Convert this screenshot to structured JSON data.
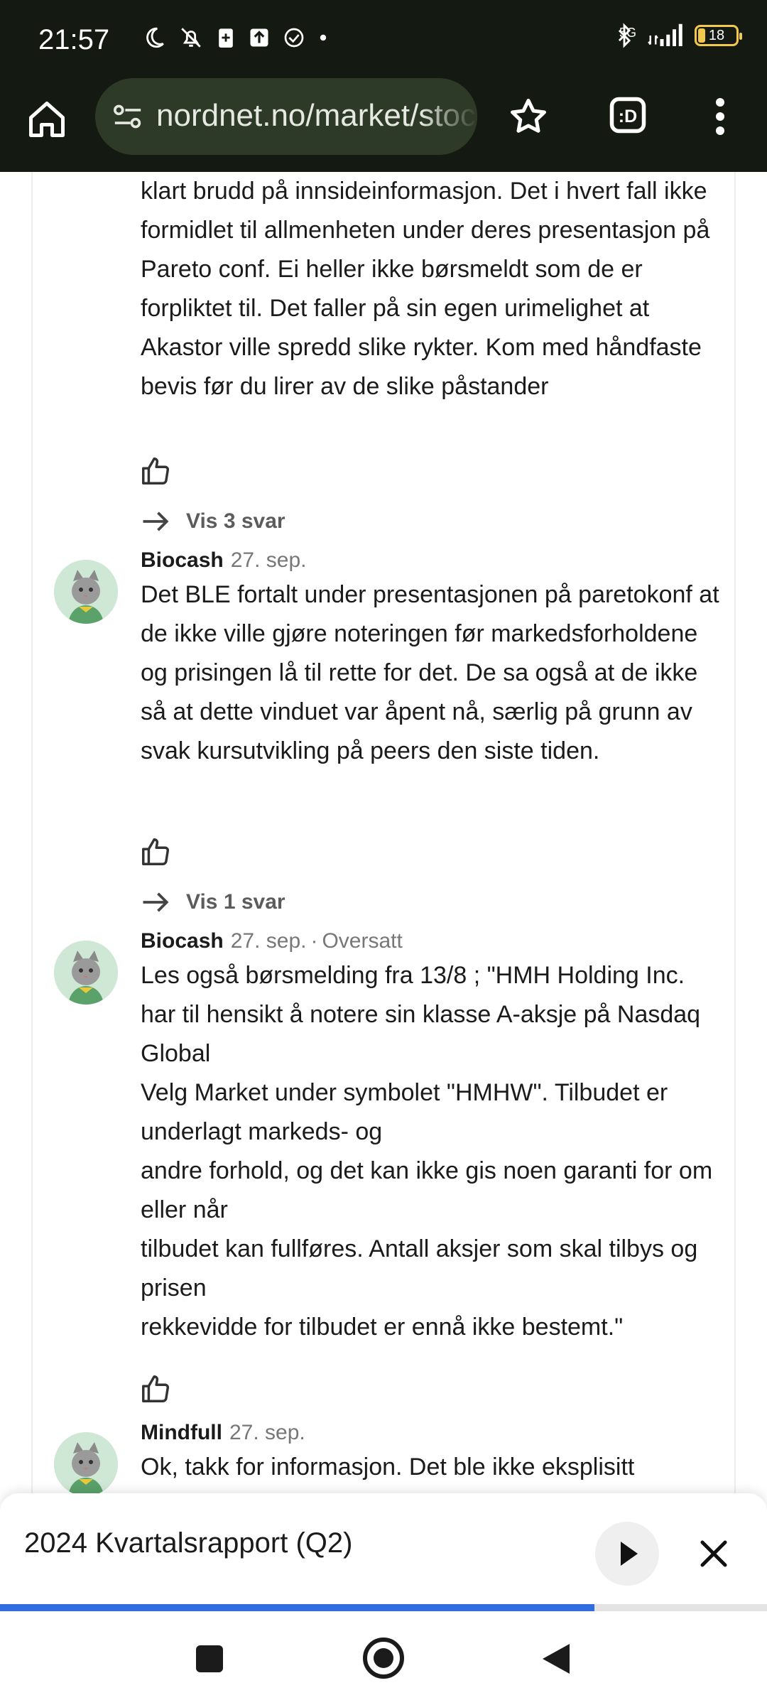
{
  "status_bar": {
    "time": "21:57",
    "network": "5G",
    "battery": "18",
    "icons": [
      "moon-icon",
      "bell-off-icon",
      "battery-saver-icon",
      "upload-icon",
      "check-circle-icon",
      "dot-icon",
      "bluetooth-icon",
      "signal-icon"
    ]
  },
  "browser": {
    "url": "nordnet.no/market/stocks",
    "icons": [
      "home-icon",
      "site-settings-icon",
      "star-icon",
      "tabs-icon",
      "more-icon"
    ]
  },
  "comments": {
    "top_text": "klart brudd på innsideinformasjon. Det i hvert fall ikke formidlet til allmenheten under deres presentasjon på Pareto conf. Ei heller ikke børsmeldt som de er forpliktet til. Det faller på sin egen urimelighet at Akastor ville spredd slike rykter. Kom med håndfaste bevis før du lirer av de slike påstander",
    "top_replies": "Vis 3 svar",
    "c1": {
      "author": "Biocash",
      "date": "27. sep.",
      "text": "Det BLE fortalt under presentasjonen på paretokonf at de ikke ville gjøre noteringen før markedsforholdene og prisingen lå til rette for det. De sa også at de ikke så at dette vinduet var åpent nå, særlig på grunn av svak kursutvikling på peers den siste tiden.",
      "replies": "Vis 1 svar"
    },
    "c2": {
      "author": "Biocash",
      "date": "27. sep.",
      "translated": "Oversatt",
      "lines": [
        "Les også børsmelding fra 13/8 ; \"HMH Holding Inc. har til hensikt å notere sin klasse A-aksje på Nasdaq Global",
        "Velg Market under symbolet \"HMHW\". Tilbudet er underlagt markeds- og",
        "andre forhold, og det kan ikke gis noen garanti for om eller når",
        "tilbudet kan fullføres. Antall aksjer som skal tilbys og prisen",
        "rekkevidde for tilbudet er ennå ikke bestemt.\""
      ]
    },
    "c3": {
      "author": "Mindfull",
      "date": "27. sep.",
      "text": "Ok, takk for informasjon. Det ble ikke eksplisitt"
    }
  },
  "player": {
    "title": "2024 Kvartalsrapport (Q2)",
    "progress_fraction": 0.775
  },
  "colors": {
    "status_bg": "#141a12",
    "url_bg": "#2e3a28",
    "progress": "#2f6de1",
    "muted_text": "#777777"
  }
}
